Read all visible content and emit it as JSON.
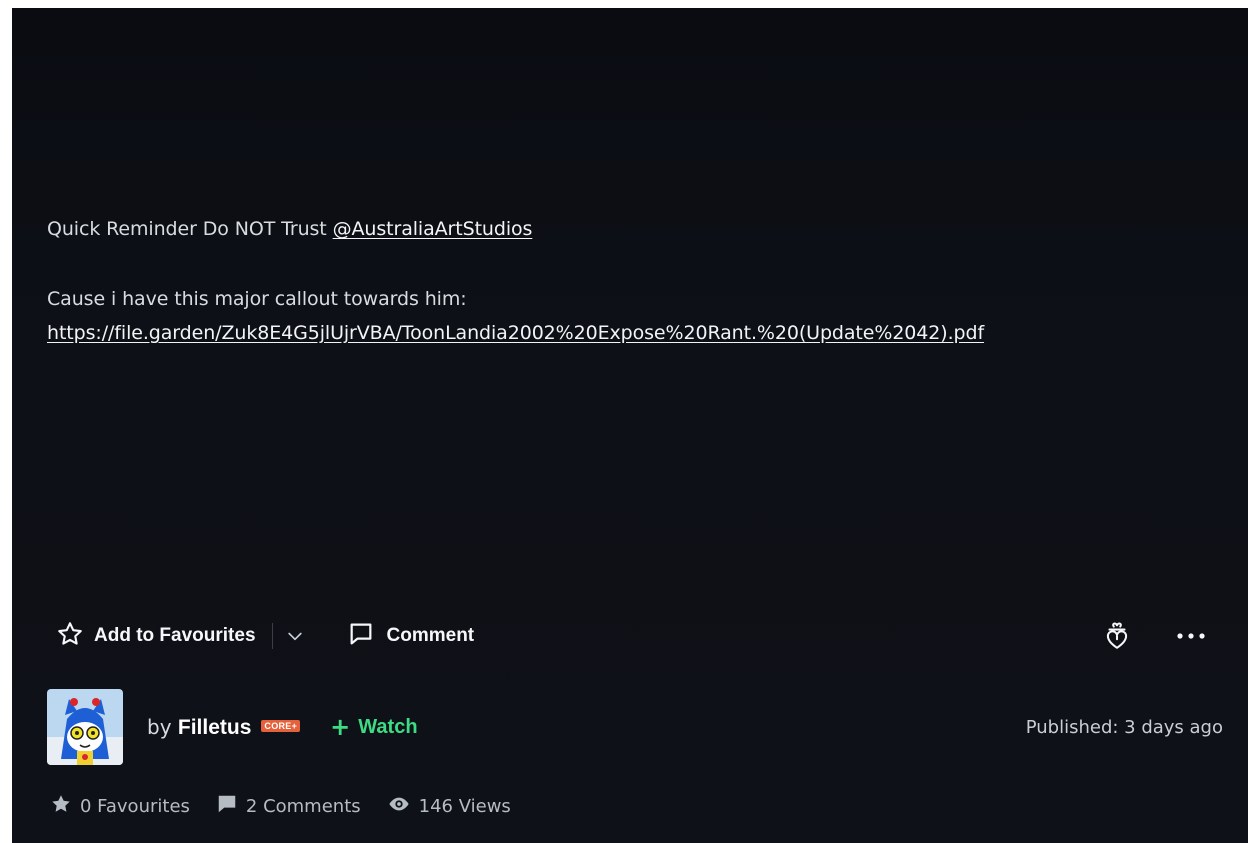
{
  "post": {
    "line1_text": "Quick Reminder Do NOT Trust ",
    "line1_mention": "@AustraliaArtStudios",
    "line2_text": "Cause i have this major callout towards him:",
    "line3_link": "https://file.garden/Zuk8E4G5jlUjrVBA/ToonLandia2002%20Expose%20Rant.%20(Update%2042).pdf"
  },
  "actions": {
    "favourite_label": "Add to Favourites",
    "comment_label": "Comment"
  },
  "author": {
    "by_label": "by",
    "name": "Filletus",
    "badge": "CORE+",
    "watch_label": "Watch",
    "published": "Published: 3 days ago"
  },
  "stats": {
    "favourites": "0 Favourites",
    "comments": "2 Comments",
    "views": "146 Views"
  },
  "colors": {
    "background": "#0e1117",
    "watch_green": "#3ddc84",
    "core_badge": "#e4613b"
  }
}
